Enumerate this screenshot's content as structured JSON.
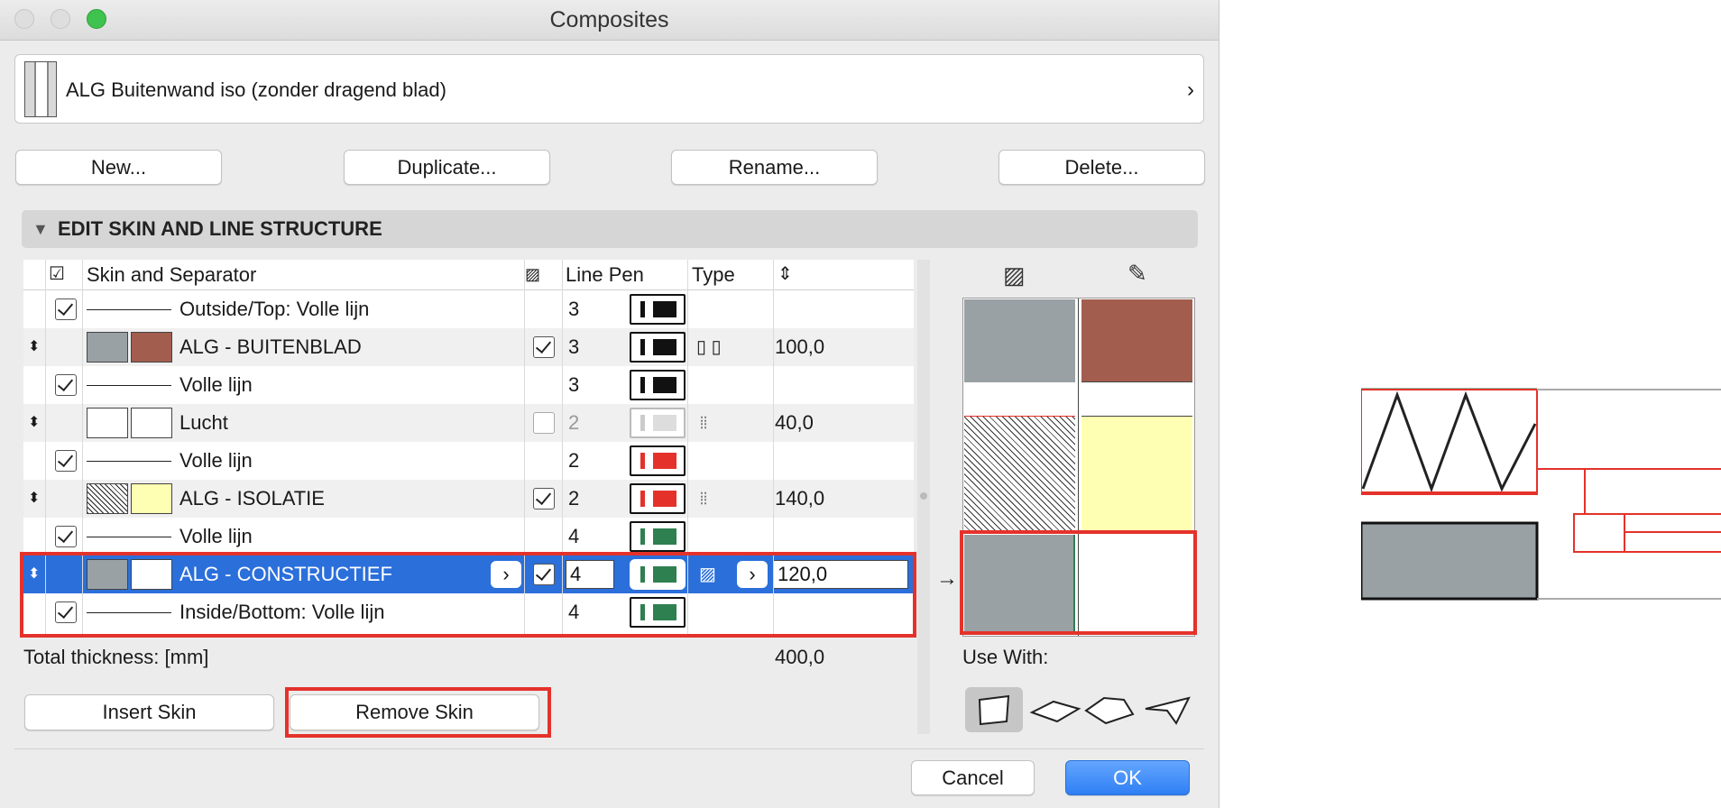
{
  "window": {
    "title": "Composites"
  },
  "selector": {
    "name": "ALG Buitenwand iso (zonder dragend blad)"
  },
  "buttons": {
    "new": "New...",
    "duplicate": "Duplicate...",
    "rename": "Rename...",
    "delete": "Delete..."
  },
  "section": {
    "title": "EDIT SKIN AND LINE STRUCTURE"
  },
  "table": {
    "headers": {
      "skin": "Skin and Separator",
      "pen": "Line Pen",
      "type": "Type"
    },
    "rows": [
      {
        "kind": "line",
        "label": "Outside/Top: Volle lijn",
        "pen": "3",
        "pen_color": "#111111",
        "checked": true
      },
      {
        "kind": "skin",
        "label": "ALG - BUITENBLAD",
        "pen": "3",
        "pen_color": "#111111",
        "thickness": "100,0",
        "swatch1": "#9aa1a5",
        "swatch2": "#a25d4f",
        "checked": true
      },
      {
        "kind": "line",
        "label": "Volle lijn",
        "pen": "3",
        "pen_color": "#111111",
        "checked": true
      },
      {
        "kind": "skin",
        "label": "Lucht",
        "pen": "2",
        "pen_color": "#d6d6d6",
        "thickness": "40,0",
        "swatch1": "#ffffff",
        "swatch2": "#ffffff",
        "checked": false
      },
      {
        "kind": "line",
        "label": "Volle lijn",
        "pen": "2",
        "pen_color": "#e4322b",
        "checked": true
      },
      {
        "kind": "skin",
        "label": "ALG - ISOLATIE",
        "pen": "2",
        "pen_color": "#e4322b",
        "thickness": "140,0",
        "swatch1": "hatch",
        "swatch2": "#ffffb3",
        "checked": true
      },
      {
        "kind": "line",
        "label": "Volle lijn",
        "pen": "4",
        "pen_color": "#2e8050",
        "checked": true
      },
      {
        "kind": "skin",
        "label": "ALG - CONSTRUCTIEF",
        "pen": "4",
        "pen_color": "#2e8050",
        "thickness": "120,0",
        "swatch1": "#9aa1a5",
        "swatch2": "#ffffff",
        "checked": true
      },
      {
        "kind": "line",
        "label": "Inside/Bottom: Volle lijn",
        "pen": "4",
        "pen_color": "#2e8050",
        "checked": true
      }
    ],
    "total_label": "Total thickness: [mm]",
    "total_value": "400,0"
  },
  "skin_buttons": {
    "insert": "Insert Skin",
    "remove": "Remove Skin"
  },
  "use_with": {
    "label": "Use With:"
  },
  "footer": {
    "cancel": "Cancel",
    "ok": "OK"
  },
  "colors": {
    "accent": "#2b6fdb",
    "highlight": "#e4322b"
  }
}
